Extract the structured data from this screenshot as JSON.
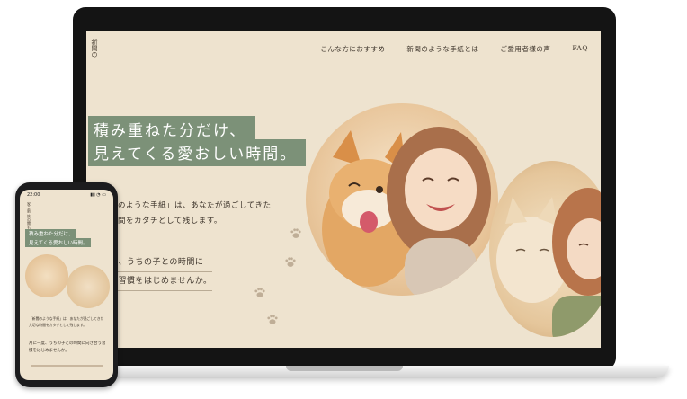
{
  "site": {
    "logo_text": "新聞の",
    "nav": [
      "こんな方におすすめ",
      "新聞のような手紙とは",
      "ご愛用者様の声",
      "FAQ"
    ],
    "hero_line1": "積み重ねた分だけ、",
    "hero_line2": "見えてくる愛おしい時間。",
    "intro_line1": "」のような手紙」は、あなたが過ごしてきた",
    "intro_line2": "時間をカタチとして残します。",
    "intro_line3": "度、うちの子との時間に",
    "intro_line4": "う習慣をはじめませんか。"
  },
  "phone": {
    "time": "22:00",
    "status_right": "▮▮ ◔ ▭",
    "logo_text": "家こ新 族の聞 もで",
    "hero_line1": "積み重ねた分だけ、",
    "hero_line2": "見えてくる愛おしい時間。",
    "intro": "「新聞のような手紙」は、あなたが過ごしてきた大切な時間をカタチとして残します。",
    "intro2": "月に一度、うちの子との時間に向き合う習慣をはじめませんか。"
  },
  "colors": {
    "background": "#eee3cf",
    "accent_green": "#7c9178",
    "text": "#3d342b"
  }
}
